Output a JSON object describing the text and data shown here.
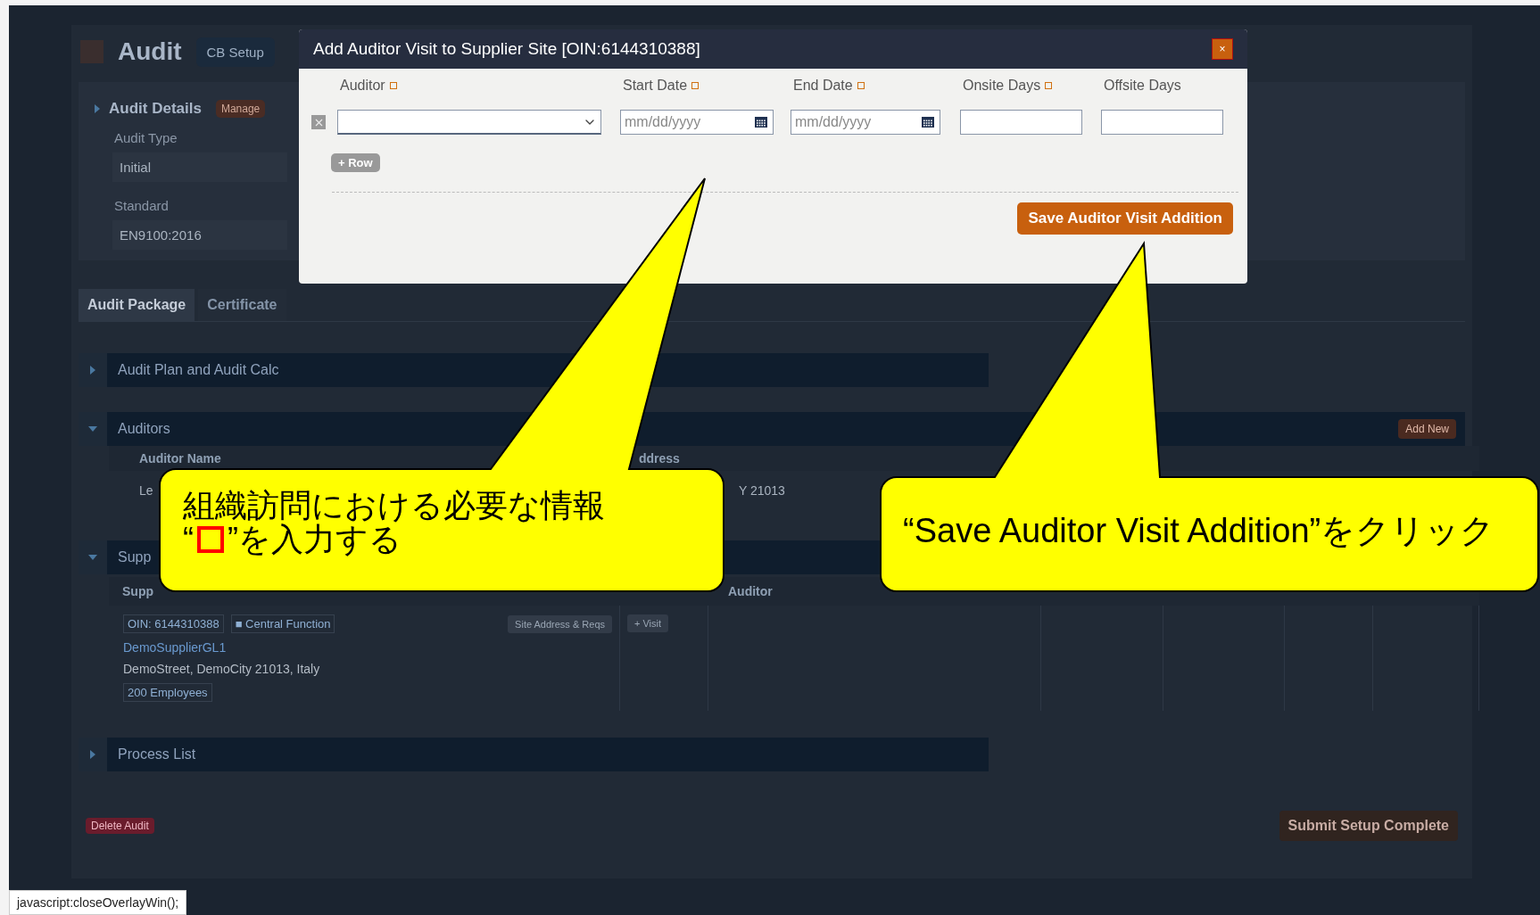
{
  "header": {
    "title": "Audit",
    "tab": "CB Setup"
  },
  "audit_details": {
    "title": "Audit Details",
    "action": "Manage",
    "fields": [
      {
        "label": "Audit Type",
        "value": "Initial"
      },
      {
        "label": "Standard",
        "value": "EN9100:2016"
      }
    ]
  },
  "tabs": [
    {
      "label": "Audit Package",
      "selected": true
    },
    {
      "label": "Certificate",
      "selected": false
    }
  ],
  "sections": [
    {
      "kind": "plain",
      "title": "Audit Plan and Audit Calc",
      "expanded": false
    },
    {
      "kind": "auditors",
      "title": "Auditors",
      "expanded": true,
      "action": "Add New",
      "columns": [
        "Auditor Name",
        "ddress"
      ],
      "rows": [
        [
          "Le",
          "Y 21013"
        ]
      ]
    },
    {
      "kind": "suppliers",
      "title": "Supp",
      "expanded": true,
      "columns": [
        "Supp",
        "Auditor"
      ],
      "site": {
        "oin": "OIN: 6144310388",
        "function": "■ Central Function",
        "site_button": "Site Address & Reqs",
        "visit_button": "+ Visit",
        "name": "DemoSupplierGL1",
        "address": "DemoStreet, DemoCity 21013, Italy",
        "employees": "200 Employees"
      }
    },
    {
      "kind": "plain",
      "title": "Process List",
      "expanded": false
    }
  ],
  "footer": {
    "delete": "Delete Audit",
    "submit": "Submit Setup Complete"
  },
  "dialog": {
    "title": "Add Auditor Visit to Supplier Site [OIN:6144310388]",
    "close": "×",
    "columns": [
      {
        "label": "Auditor",
        "required": true
      },
      {
        "label": "Start Date",
        "required": true
      },
      {
        "label": "End Date",
        "required": true
      },
      {
        "label": "Onsite Days",
        "required": true
      },
      {
        "label": "Offsite Days",
        "required": false
      }
    ],
    "row": {
      "start_placeholder": "mm/dd/yyyy",
      "end_placeholder": "mm/dd/yyyy"
    },
    "add_row": "+ Row",
    "save": "Save Auditor Visit Addition"
  },
  "callouts": [
    {
      "lines": [
        "組織訪問における必要な情報"
      ],
      "marker_line": {
        "before": "“",
        "after": "”を入力する"
      }
    },
    {
      "lines": [
        "“Save Auditor Visit Addition”をクリック"
      ]
    }
  ],
  "status_text": "javascript:closeOverlayWin();"
}
